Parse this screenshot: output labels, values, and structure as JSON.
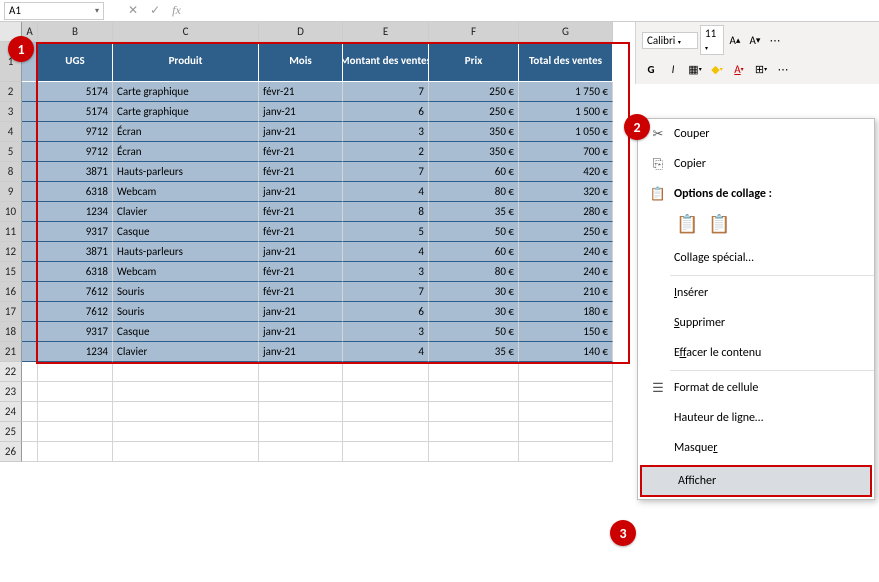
{
  "name_box": "A1",
  "ribbon": {
    "font_name": "Calibri",
    "font_size": "11",
    "bold": "G",
    "italic": "I"
  },
  "columns": [
    "A",
    "B",
    "C",
    "D",
    "E",
    "F",
    "G"
  ],
  "visible_rows": [
    "1",
    "2",
    "3",
    "4",
    "5",
    "8",
    "9",
    "10",
    "11",
    "12",
    "15",
    "16",
    "17",
    "18",
    "21",
    "22",
    "23",
    "24",
    "25",
    "26"
  ],
  "headers": {
    "ugs": "UGS",
    "produit": "Produit",
    "mois": "Mois",
    "montant": "Montant des ventes",
    "prix": "Prix",
    "total": "Total des ventes"
  },
  "rows": [
    {
      "ugs": "5174",
      "produit": "Carte graphique",
      "mois": "févr-21",
      "montant": "7",
      "prix": "250 €",
      "total": "1 750 €"
    },
    {
      "ugs": "5174",
      "produit": "Carte graphique",
      "mois": "janv-21",
      "montant": "6",
      "prix": "250 €",
      "total": "1 500 €"
    },
    {
      "ugs": "9712",
      "produit": "Écran",
      "mois": "janv-21",
      "montant": "3",
      "prix": "350 €",
      "total": "1 050 €"
    },
    {
      "ugs": "9712",
      "produit": "Écran",
      "mois": "févr-21",
      "montant": "2",
      "prix": "350 €",
      "total": "700 €"
    },
    {
      "ugs": "3871",
      "produit": "Hauts-parleurs",
      "mois": "févr-21",
      "montant": "7",
      "prix": "60 €",
      "total": "420 €"
    },
    {
      "ugs": "6318",
      "produit": "Webcam",
      "mois": "janv-21",
      "montant": "4",
      "prix": "80 €",
      "total": "320 €"
    },
    {
      "ugs": "1234",
      "produit": "Clavier",
      "mois": "févr-21",
      "montant": "8",
      "prix": "35 €",
      "total": "280 €"
    },
    {
      "ugs": "9317",
      "produit": "Casque",
      "mois": "févr-21",
      "montant": "5",
      "prix": "50 €",
      "total": "250 €"
    },
    {
      "ugs": "3871",
      "produit": "Hauts-parleurs",
      "mois": "janv-21",
      "montant": "4",
      "prix": "60 €",
      "total": "240 €"
    },
    {
      "ugs": "6318",
      "produit": "Webcam",
      "mois": "févr-21",
      "montant": "3",
      "prix": "80 €",
      "total": "240 €"
    },
    {
      "ugs": "7612",
      "produit": "Souris",
      "mois": "févr-21",
      "montant": "7",
      "prix": "30 €",
      "total": "210 €"
    },
    {
      "ugs": "7612",
      "produit": "Souris",
      "mois": "janv-21",
      "montant": "6",
      "prix": "30 €",
      "total": "180 €"
    },
    {
      "ugs": "9317",
      "produit": "Casque",
      "mois": "janv-21",
      "montant": "3",
      "prix": "50 €",
      "total": "150 €"
    },
    {
      "ugs": "1234",
      "produit": "Clavier",
      "mois": "janv-21",
      "montant": "4",
      "prix": "35 €",
      "total": "140 €"
    }
  ],
  "context_menu": {
    "cut": "Couper",
    "copy": "Copier",
    "paste_options": "Options de collage :",
    "paste_special": "Collage spécial…",
    "insert": "Insérer",
    "delete": "Supprimer",
    "clear": "Effacer le contenu",
    "format": "Format de cellule",
    "row_height": "Hauteur de ligne…",
    "hide": "Masquer",
    "show": "Afficher"
  },
  "badges": {
    "one": "1",
    "two": "2",
    "three": "3"
  }
}
